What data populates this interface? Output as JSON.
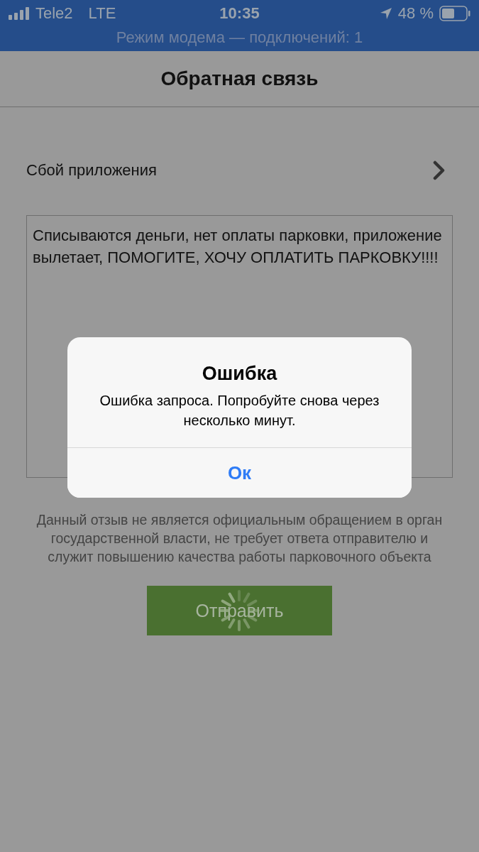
{
  "status_bar": {
    "carrier": "Tele2",
    "network": "LTE",
    "time": "10:35",
    "battery": "48 %"
  },
  "hotspot_banner": "Режим модема — подключений: 1",
  "header": {
    "title": "Обратная связь"
  },
  "category": {
    "label": "Сбой приложения"
  },
  "feedback": {
    "value": "Списываются деньги, нет оплаты парковки, приложение вылетает, ПОМОГИТЕ, ХОЧУ ОПЛАТИТЬ ПАРКОВКУ!!!!"
  },
  "disclaimer": "Данный отзыв не является официальным обращением в орган государственной власти, не требует ответа отправителю и служит повышению качества работы парковочного объекта",
  "submit_button": {
    "label": "Отправить",
    "loading": true
  },
  "dialog": {
    "title": "Ошибка",
    "message": "Ошибка запроса. Попробуйте снова через несколько минут.",
    "buttons": [
      "Ок"
    ]
  }
}
